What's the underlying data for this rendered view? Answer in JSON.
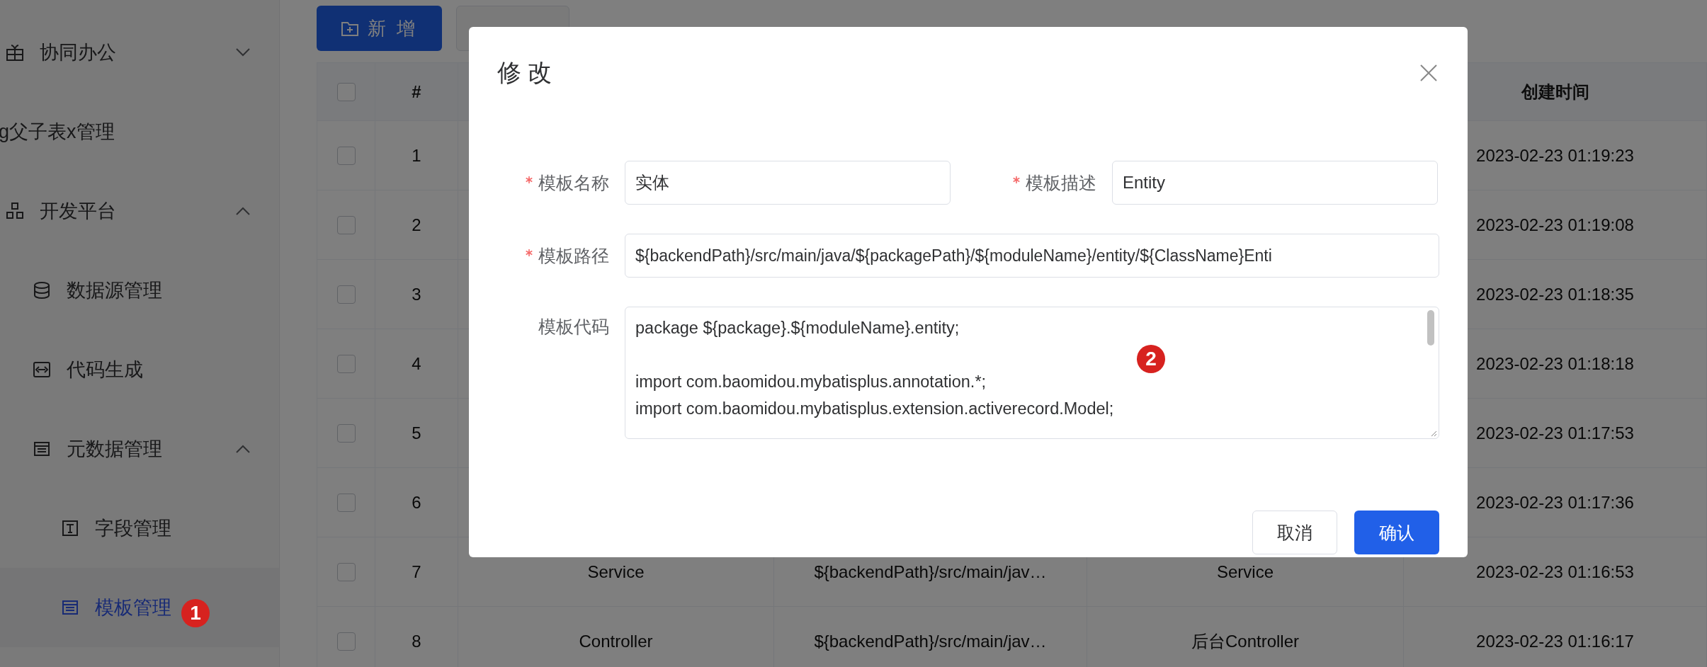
{
  "sidebar": {
    "items": [
      {
        "label": "协同办公",
        "expanded": false,
        "selected": false
      },
      {
        "label": "g父子表x管理",
        "selected": false
      },
      {
        "label": "开发平台",
        "expanded": true,
        "selected": false,
        "children": [
          {
            "label": "数据源管理",
            "selected": false
          },
          {
            "label": "代码生成",
            "selected": false
          },
          {
            "label": "元数据管理",
            "expanded": true,
            "selected": false,
            "children": [
              {
                "label": "字段管理",
                "selected": false
              },
              {
                "label": "模板管理",
                "selected": true
              }
            ]
          }
        ]
      }
    ]
  },
  "toolbar": {
    "buttons": [
      {
        "label": "新 增",
        "kind": "primary"
      },
      {
        "kind": "plain"
      }
    ]
  },
  "table": {
    "header": {
      "select_all": {
        "checked": false
      },
      "index": "#",
      "created": "创建时间"
    },
    "rows": [
      {
        "checked": false,
        "index": "1",
        "created": "2023-02-23 01:19:23"
      },
      {
        "checked": false,
        "index": "2",
        "created": "2023-02-23 01:19:08"
      },
      {
        "checked": false,
        "index": "3",
        "created": "2023-02-23 01:18:35"
      },
      {
        "checked": false,
        "index": "4",
        "created": "2023-02-23 01:18:18"
      },
      {
        "checked": false,
        "index": "5",
        "created": "2023-02-23 01:17:53"
      },
      {
        "checked": false,
        "index": "6",
        "created": "2023-02-23 01:17:36"
      },
      {
        "checked": false,
        "index": "7",
        "name": "Service",
        "path": "${backendPath}/src/main/jav…",
        "description": "Service",
        "created": "2023-02-23 01:16:53"
      },
      {
        "checked": false,
        "index": "8",
        "name": "Controller",
        "path": "${backendPath}/src/main/jav…",
        "description": "后台Controller",
        "created": "2023-02-23 01:16:17"
      }
    ]
  },
  "dialog": {
    "title": "修 改",
    "fields": {
      "name": {
        "label": "模板名称",
        "required": true,
        "value": "实体"
      },
      "description": {
        "label": "模板描述",
        "required": true,
        "value": "Entity"
      },
      "path": {
        "label": "模板路径",
        "required": true,
        "value": "${backendPath}/src/main/java/${packagePath}/${moduleName}/entity/${ClassName}Enti"
      },
      "code": {
        "label": "模板代码",
        "required": false,
        "value": "package ${package}.${moduleName}.entity;\n\nimport com.baomidou.mybatisplus.annotation.*;\nimport com.baomidou.mybatisplus.extension.activerecord.Model;"
      }
    },
    "buttons": [
      {
        "label": "取消",
        "kind": "plain"
      },
      {
        "label": "确认",
        "kind": "primary"
      }
    ]
  },
  "markers": [
    {
      "label": "1"
    },
    {
      "label": "2"
    }
  ]
}
